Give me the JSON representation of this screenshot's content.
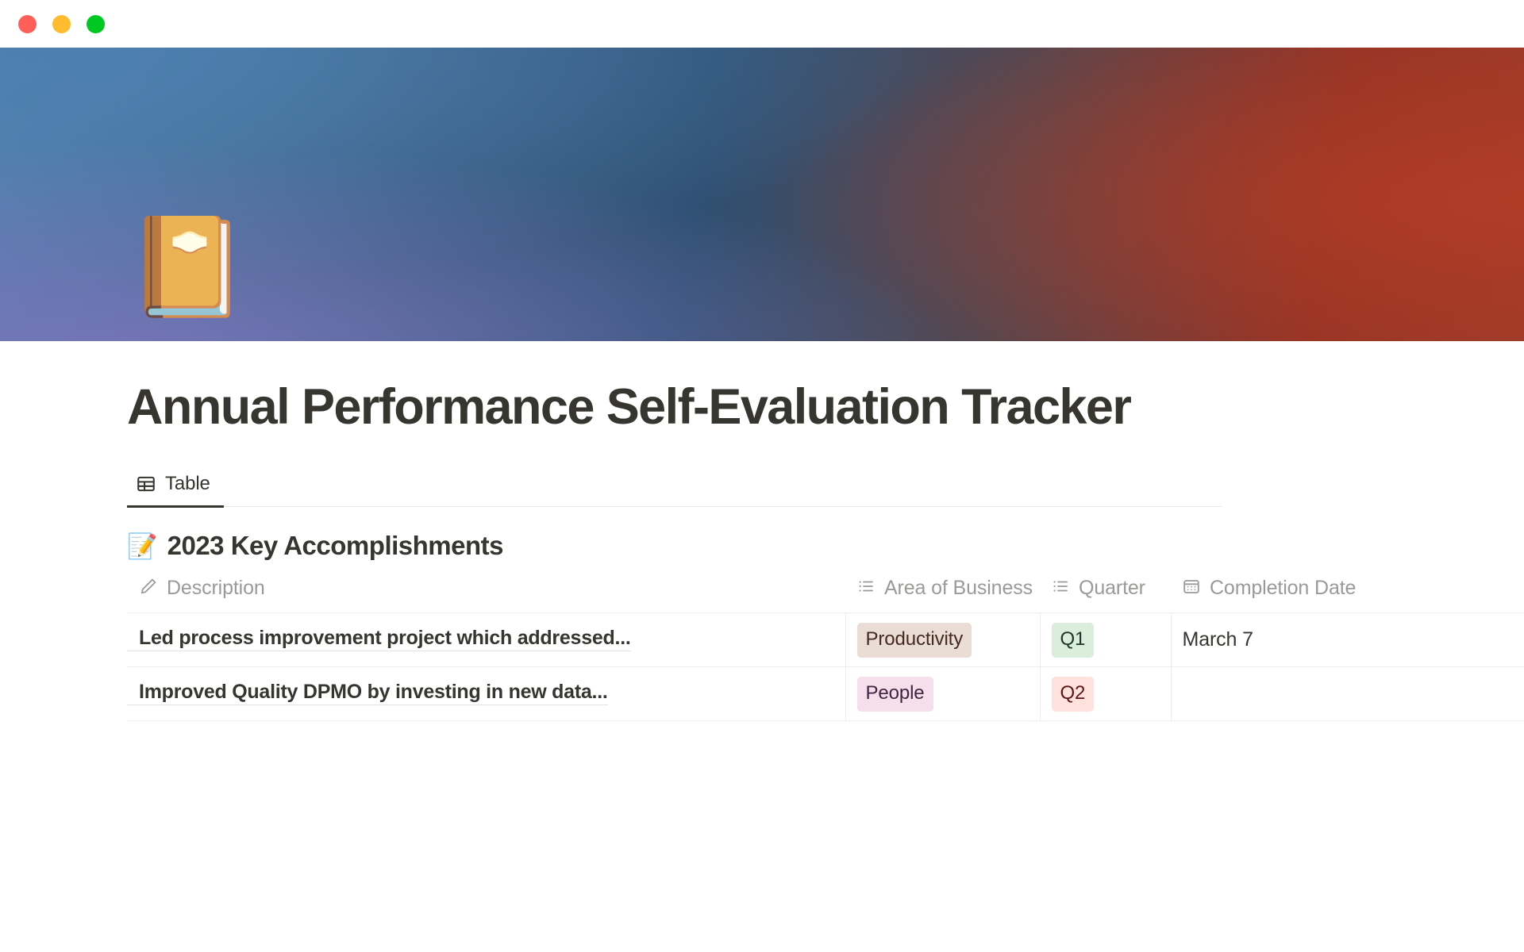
{
  "window": {
    "traffic_lights": [
      {
        "name": "close-button",
        "color": "#FF5F57"
      },
      {
        "name": "minimize-button",
        "color": "#FEBC2E"
      },
      {
        "name": "maximize-button",
        "color": "#00C823"
      }
    ]
  },
  "cover": {
    "gradient_colors": [
      "#5581AE",
      "#2E4F72",
      "#7975BA",
      "#903225",
      "#9A3A2A"
    ]
  },
  "page": {
    "icon": "📔",
    "icon_name": "notebook-with-decorative-cover-emoji",
    "title": "Annual Performance Self-Evaluation Tracker"
  },
  "view_tabs": [
    {
      "label": "Table",
      "icon": "table-icon",
      "active": true
    }
  ],
  "database": {
    "emoji": "📝",
    "emoji_name": "memo-emoji",
    "title": "2023 Key Accomplishments",
    "columns": [
      {
        "label": "Description",
        "icon": "pencil-icon"
      },
      {
        "label": "Area of Business",
        "icon": "list-icon"
      },
      {
        "label": "Quarter",
        "icon": "list-icon"
      },
      {
        "label": "Completion Date",
        "icon": "calendar-icon",
        "truncated_label": "Com"
      }
    ],
    "rows": [
      {
        "description": "Led process improvement project which addressed...",
        "area_of_business": "Productivity",
        "area_class": "pill-productivity",
        "quarter": "Q1",
        "quarter_class": "pill-q1",
        "completion_date": "March 7"
      },
      {
        "description": "Improved Quality DPMO by investing in new data...",
        "area_of_business": "People",
        "area_class": "pill-people",
        "quarter": "Q2",
        "quarter_class": "pill-q2",
        "completion_date": ""
      }
    ]
  },
  "colors": {
    "text_primary": "#37352F",
    "text_muted": "#9B9A97",
    "border": "#EDECEA",
    "tag_productivity_bg": "#EADDD5",
    "tag_q1_bg": "#DBEDDB",
    "tag_people_bg": "#F4DFEB",
    "tag_q2_bg": "#FFE2DD"
  }
}
